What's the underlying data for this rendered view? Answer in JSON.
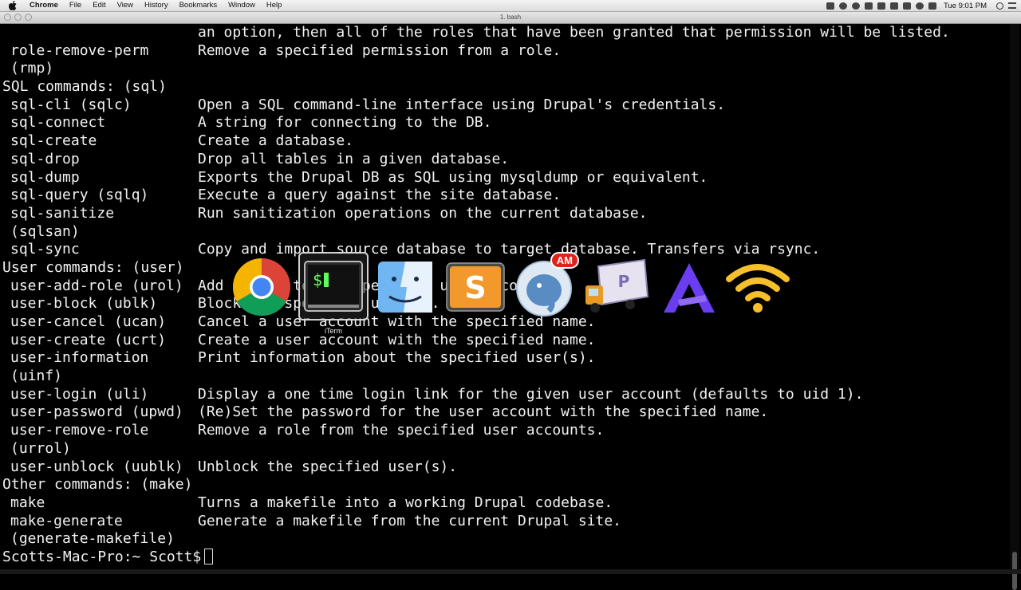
{
  "menubar": {
    "app_name": "Chrome",
    "items": [
      "File",
      "Edit",
      "View",
      "History",
      "Bookmarks",
      "Window",
      "Help"
    ],
    "clock": "Tue 9:01 PM"
  },
  "window": {
    "title": "1. bash"
  },
  "terminal": {
    "lines": [
      {
        "kind": "desc",
        "cmd": "",
        "desc": "an option, then all of the roles that have been granted that permission will be listed."
      },
      {
        "kind": "row",
        "cmd": "role-remove-perm",
        "desc": "Remove a specified permission from a role."
      },
      {
        "kind": "row",
        "cmd": "(rmp)",
        "desc": ""
      },
      {
        "kind": "header",
        "text": "SQL commands: (sql)"
      },
      {
        "kind": "row",
        "cmd": "sql-cli (sqlc)",
        "desc": "Open a SQL command-line interface using Drupal's credentials."
      },
      {
        "kind": "row",
        "cmd": "sql-connect",
        "desc": "A string for connecting to the DB."
      },
      {
        "kind": "row",
        "cmd": "sql-create",
        "desc": "Create a database."
      },
      {
        "kind": "row",
        "cmd": "sql-drop",
        "desc": "Drop all tables in a given database."
      },
      {
        "kind": "row",
        "cmd": "sql-dump",
        "desc": "Exports the Drupal DB as SQL using mysqldump or equivalent."
      },
      {
        "kind": "row",
        "cmd": "sql-query (sqlq)",
        "desc": "Execute a query against the site database."
      },
      {
        "kind": "row",
        "cmd": "sql-sanitize",
        "desc": "Run sanitization operations on the current database."
      },
      {
        "kind": "row",
        "cmd": "(sqlsan)",
        "desc": ""
      },
      {
        "kind": "row",
        "cmd": "sql-sync",
        "desc": "Copy and import source database to target database. Transfers via rsync."
      },
      {
        "kind": "header",
        "text": "User commands: (user)"
      },
      {
        "kind": "row",
        "cmd": "user-add-role (urol)",
        "desc": "Add a role to the specified user accounts."
      },
      {
        "kind": "row",
        "cmd": "user-block (ublk)",
        "desc": "Block the specified user(s)."
      },
      {
        "kind": "row",
        "cmd": "user-cancel (ucan)",
        "desc": "Cancel a user account with the specified name."
      },
      {
        "kind": "row",
        "cmd": "user-create (ucrt)",
        "desc": "Create a user account with the specified name."
      },
      {
        "kind": "row",
        "cmd": "user-information",
        "desc": "Print information about the specified user(s)."
      },
      {
        "kind": "row",
        "cmd": "(uinf)",
        "desc": ""
      },
      {
        "kind": "row",
        "cmd": "user-login (uli)",
        "desc": "Display a one time login link for the given user account (defaults to uid 1)."
      },
      {
        "kind": "row",
        "cmd": "user-password (upwd)",
        "desc": "(Re)Set the password for the user account with the specified name."
      },
      {
        "kind": "row",
        "cmd": "user-remove-role",
        "desc": "Remove a role from the specified user accounts."
      },
      {
        "kind": "row",
        "cmd": "(urrol)",
        "desc": ""
      },
      {
        "kind": "row",
        "cmd": "user-unblock (uublk)",
        "desc": "Unblock the specified user(s)."
      },
      {
        "kind": "header",
        "text": "Other commands: (make)"
      },
      {
        "kind": "row",
        "cmd": "make",
        "desc": "Turns a makefile into a working Drupal codebase."
      },
      {
        "kind": "row",
        "cmd": "make-generate",
        "desc": "Generate a makefile from the current Drupal site."
      },
      {
        "kind": "row",
        "cmd": "(generate-makefile)",
        "desc": ""
      }
    ],
    "prompt": "Scotts-Mac-Pro:~ Scott$"
  },
  "switcher": {
    "selected_label": "iTerm",
    "apps": [
      {
        "name": "chrome-app-icon",
        "icon": "chrome"
      },
      {
        "name": "iterm-app-icon",
        "icon": "terminal",
        "selected": true
      },
      {
        "name": "finder-app-icon",
        "icon": "finder"
      },
      {
        "name": "sublime-app-icon",
        "icon": "sublime",
        "letter": "S"
      },
      {
        "name": "sequel-pro-app-icon",
        "icon": "elephant",
        "badge": "AM"
      },
      {
        "name": "transmit-app-icon",
        "icon": "truck"
      },
      {
        "name": "arc-app-icon",
        "icon": "arc"
      },
      {
        "name": "wifi-app-icon",
        "icon": "wifi"
      }
    ]
  },
  "colors": {
    "terminal_bg": "#000000",
    "terminal_fg": "#f2f2f2",
    "badge_red": "#e0221c",
    "sublime_orange": "#f19a2b",
    "arc_purple": "#6b3df0",
    "wifi_yellow": "#f5c02a"
  }
}
